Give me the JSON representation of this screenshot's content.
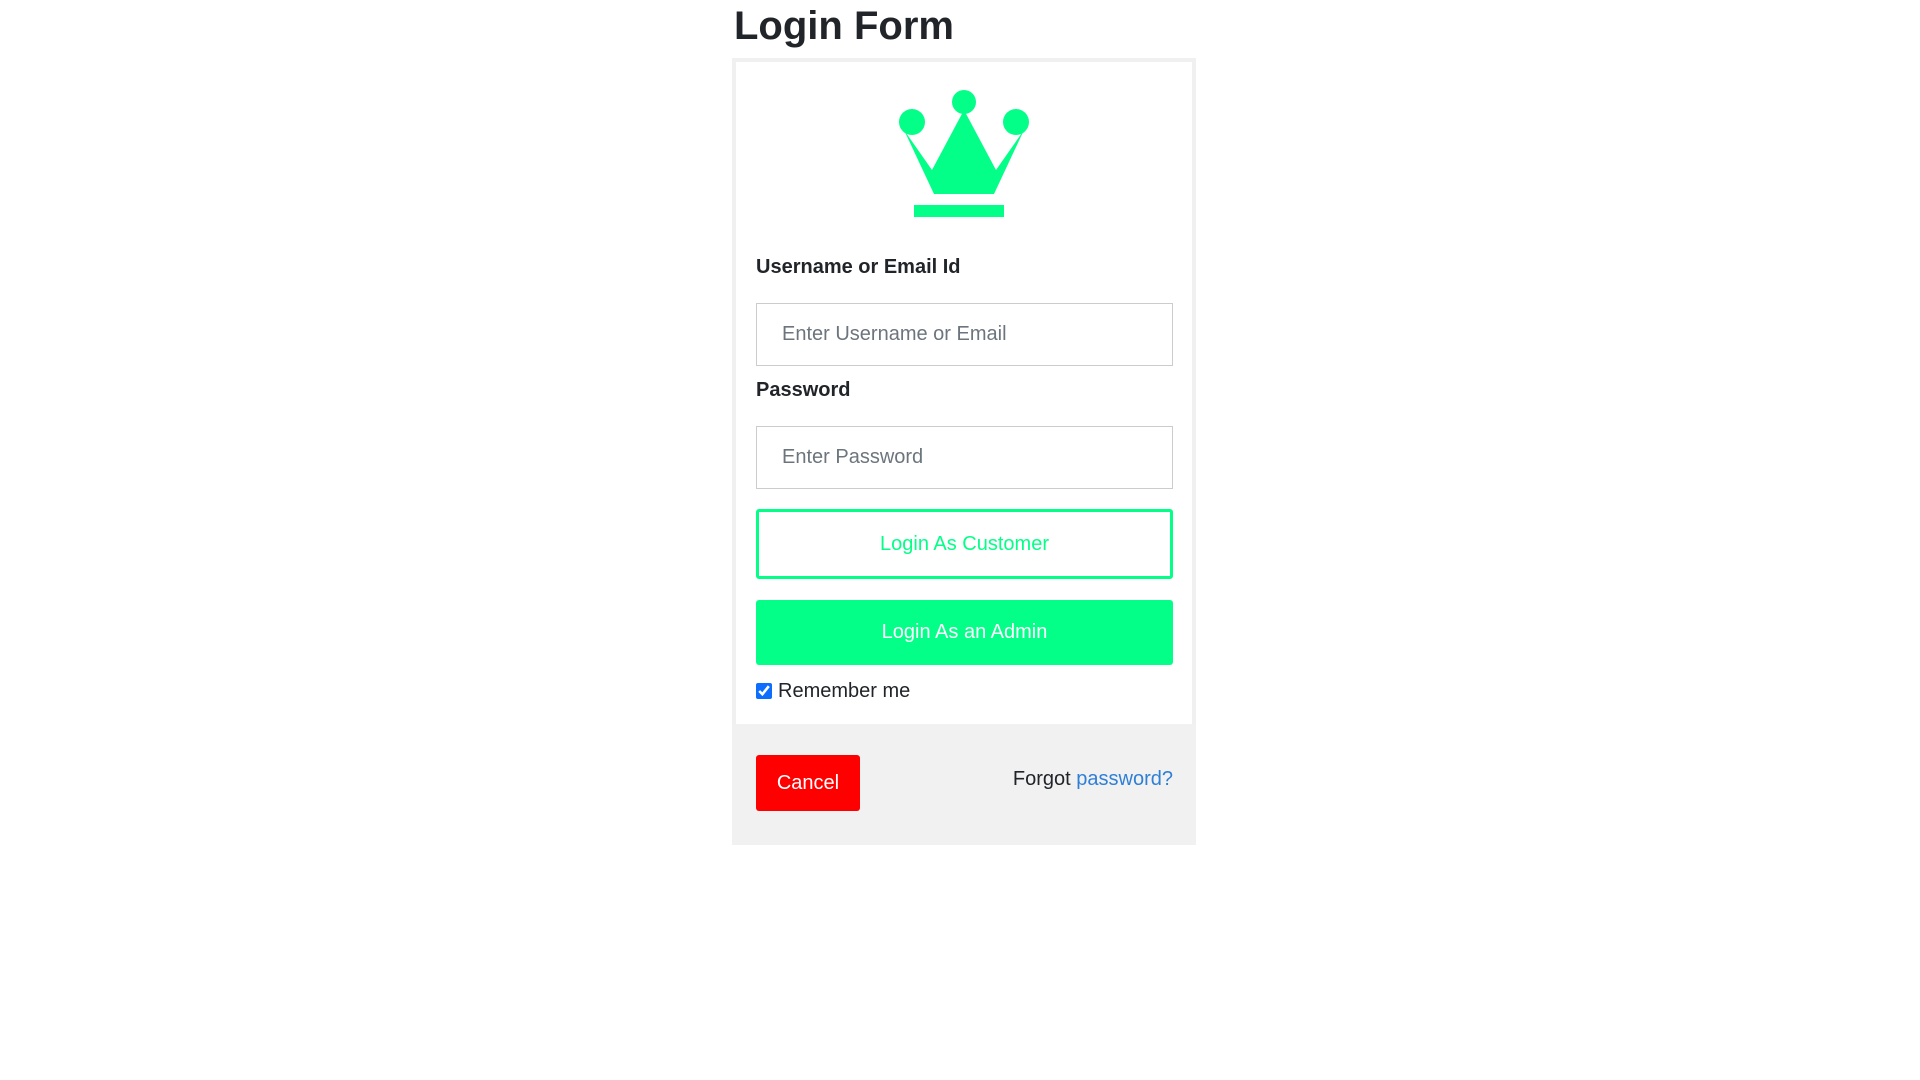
{
  "page": {
    "title": "Login Form"
  },
  "logo": {
    "icon": "crown-icon",
    "color": "#04ff88"
  },
  "form": {
    "username": {
      "label": "Username or Email Id",
      "placeholder": "Enter Username or Email",
      "value": ""
    },
    "password": {
      "label": "Password",
      "placeholder": "Enter Password",
      "value": ""
    },
    "customer_button_label": "Login As Customer",
    "admin_button_label": "Login As an Admin",
    "remember": {
      "label": "Remember me",
      "checked": true
    }
  },
  "footer": {
    "cancel_label": "Cancel",
    "forgot_prefix": "Forgot",
    "forgot_link": "password?"
  },
  "colors": {
    "accent": "#04ff88",
    "cancel": "#ff0000",
    "link": "#2f7fd6"
  }
}
